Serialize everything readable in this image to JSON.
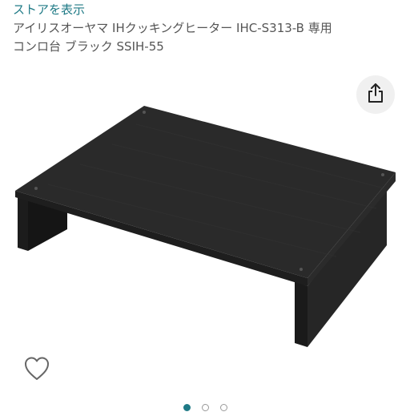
{
  "store_link": "ストアを表示",
  "title_line1": "アイリスオーヤマ IHクッキングヒーター IHC-S313-B 専用",
  "title_line2": "コンロ台 ブラック SSIH-55",
  "icons": {
    "share": "share-icon",
    "favorite": "heart-outline-icon"
  },
  "carousel": {
    "count": 3,
    "active_index": 0
  },
  "colors": {
    "accent": "#1f7a86",
    "text": "#555555",
    "product": "#2a2a2a"
  }
}
